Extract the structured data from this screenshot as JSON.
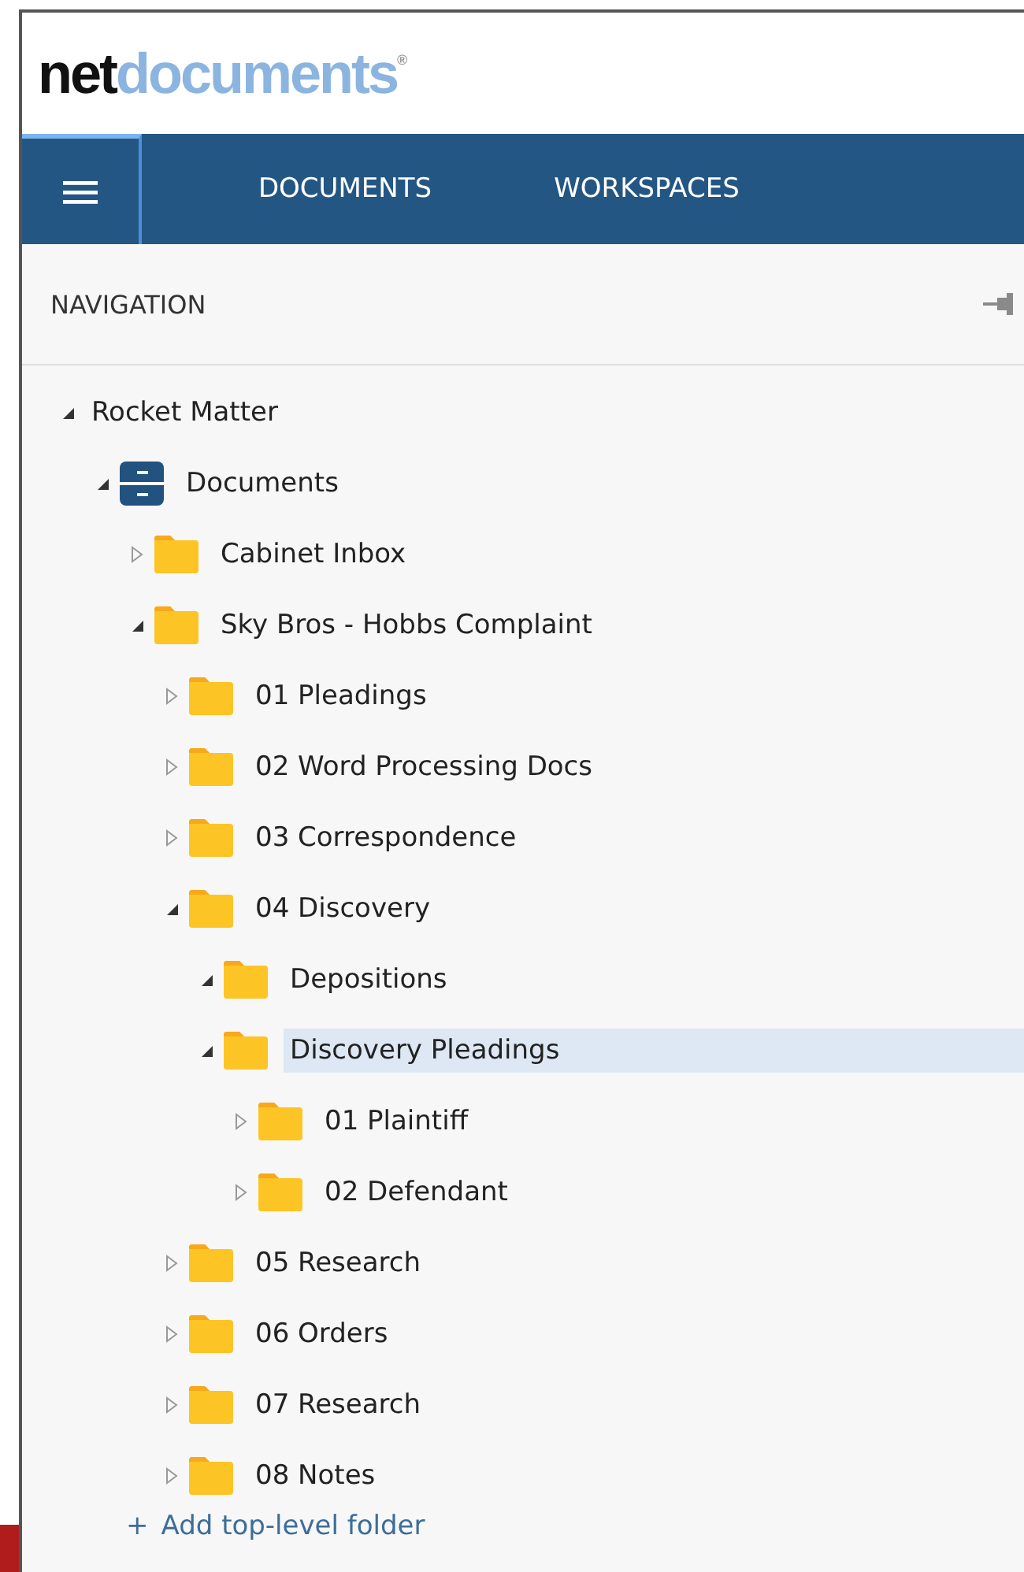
{
  "logo": {
    "part_1": "net",
    "part_2": "documents",
    "mark": "®"
  },
  "nav_bar": {
    "tabs": [
      {
        "label": "DOCUMENTS",
        "selected": false
      },
      {
        "label": "WORKSPACES",
        "selected": false
      }
    ]
  },
  "navigation": {
    "title": "NAVIGATION"
  },
  "tree": [
    {
      "label": "Rocket Matter",
      "expanded": true,
      "selected": false,
      "children": [
        {
          "label": "Documents",
          "kind": "cabinet",
          "expanded": true,
          "selected": false,
          "children": [
            {
              "label": "Cabinet Inbox",
              "kind": "folder",
              "expanded": false,
              "selected": false
            },
            {
              "label": "Sky Bros - Hobbs Complaint",
              "kind": "folder",
              "expanded": true,
              "selected": false,
              "children": [
                {
                  "label": "01 Pleadings",
                  "kind": "folder",
                  "expanded": false,
                  "selected": false
                },
                {
                  "label": "02 Word Processing Docs",
                  "kind": "folder",
                  "expanded": false,
                  "selected": false
                },
                {
                  "label": "03 Correspondence",
                  "kind": "folder",
                  "expanded": false,
                  "selected": false
                },
                {
                  "label": "04 Discovery",
                  "kind": "folder",
                  "expanded": true,
                  "selected": false,
                  "children": [
                    {
                      "label": "Depositions",
                      "kind": "folder",
                      "expanded": true,
                      "selected": false
                    },
                    {
                      "label": "Discovery Pleadings",
                      "kind": "folder",
                      "expanded": true,
                      "selected": true,
                      "children": [
                        {
                          "label": "01 Plaintiff",
                          "kind": "folder",
                          "expanded": false,
                          "selected": false
                        },
                        {
                          "label": "02 Defendant",
                          "kind": "folder",
                          "expanded": false,
                          "selected": false
                        }
                      ]
                    }
                  ]
                },
                {
                  "label": "05 Research",
                  "kind": "folder",
                  "expanded": false,
                  "selected": false
                },
                {
                  "label": "06 Orders",
                  "kind": "folder",
                  "expanded": false,
                  "selected": false
                },
                {
                  "label": "07 Research",
                  "kind": "folder",
                  "expanded": false,
                  "selected": false
                },
                {
                  "label": "08 Notes",
                  "kind": "folder",
                  "expanded": false,
                  "selected": false
                }
              ]
            }
          ]
        }
      ]
    }
  ],
  "add_folder": {
    "icon": "+",
    "label": "Add top-level folder"
  }
}
